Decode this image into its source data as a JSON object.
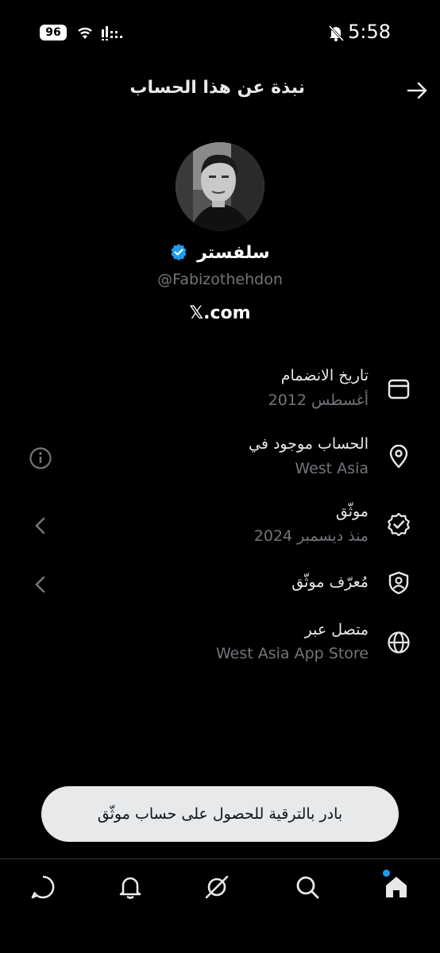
{
  "status_bar": {
    "battery": "96",
    "time": "5:58"
  },
  "header": {
    "title": "نبذة عن هذا الحساب"
  },
  "profile": {
    "name": "سلفستر",
    "handle": "@Fabizothehdon",
    "website": "𝕏.com"
  },
  "rows": [
    {
      "title": "تاريخ الانضمام",
      "subtitle": "أغسطس 2012"
    },
    {
      "title": "الحساب موجود في",
      "subtitle": "West Asia"
    },
    {
      "title": "موثّق",
      "subtitle": "منذ ديسمبر 2024"
    },
    {
      "title": "مُعرّف موثّق",
      "subtitle": ""
    },
    {
      "title": "متصل عبر",
      "subtitle": "West Asia App Store"
    }
  ],
  "upgrade_button": {
    "label": "بادر بالترقية للحصول على حساب موثّق"
  },
  "colors": {
    "background": "#000000",
    "text": "#e7e9ea",
    "muted": "#71767b",
    "verified": "#1d9bf0"
  },
  "bottom_nav": [
    "home-icon",
    "search-icon",
    "grok-icon",
    "notifications-icon",
    "messages-icon"
  ]
}
